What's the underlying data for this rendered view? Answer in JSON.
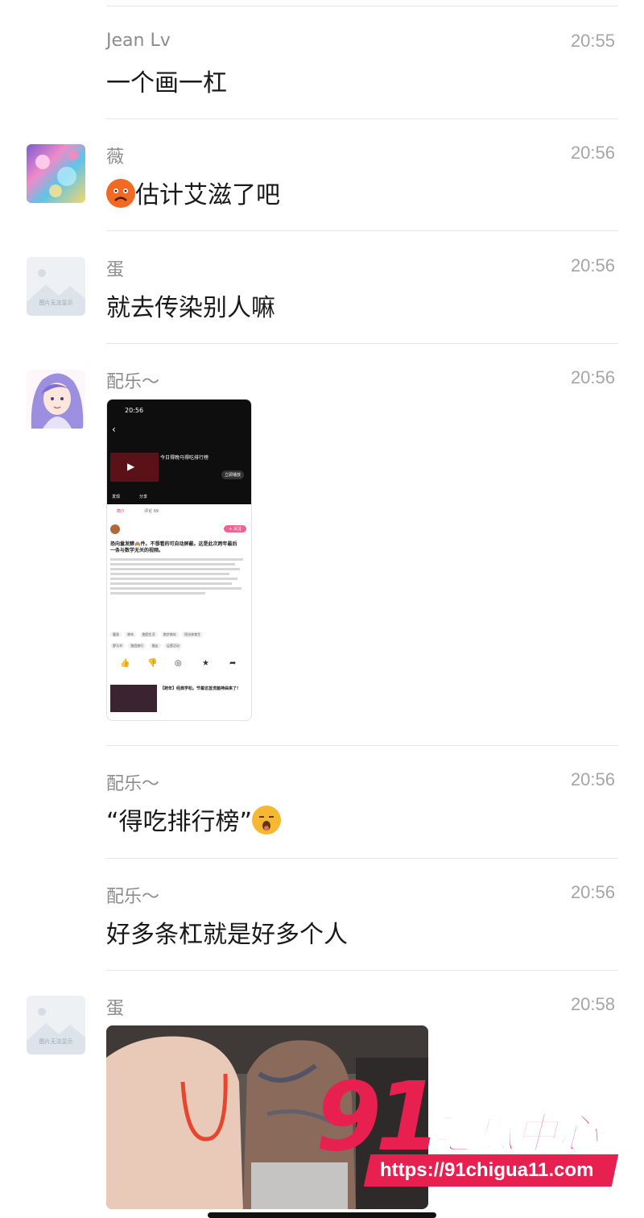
{
  "messages": [
    {
      "sender": "Jean Lv",
      "time": "20:55",
      "text": "一个画一杠"
    },
    {
      "sender": "薇",
      "time": "20:56",
      "text": "估计艾滋了吧"
    },
    {
      "sender": "蛋",
      "time": "20:56",
      "text": "就去传染别人嘛"
    },
    {
      "sender": "配乐～",
      "time": "20:56"
    },
    {
      "sender": "配乐～",
      "time": "20:56",
      "text": "“得吃排行榜”"
    },
    {
      "sender": "配乐～",
      "time": "20:56",
      "text": "好多条杠就是好多个人"
    },
    {
      "sender": "蛋",
      "time": "20:58"
    }
  ],
  "placeholder_avatar_caption": "图片无法显示",
  "screenshot": {
    "status_time": "20:56",
    "video_title": "今日得晚马得吃排行榜",
    "play_button": "立即播放",
    "actions": [
      "发现",
      "分享"
    ],
    "tabs": [
      "简介",
      "评论 99"
    ],
    "follow_label": "+ 关注",
    "post_headline": "恐向童发酵🙈件。不想看的可自动屏蔽。这是此次跨年最后一条与数学无关的视频。",
    "tags": [
      "健身",
      "跨年",
      "跑团生活",
      "跑步跨年",
      "阳光体育生",
      "野马书",
      "跑团旅行",
      "推友",
      "运营活动"
    ],
    "rec_title": "【跨年】经典学松。节着这首洗脑神曲来了!"
  },
  "watermark": {
    "number": "91",
    "brand": "吃瓜中心",
    "url": "https://91chigua11.com"
  },
  "colors": {
    "watermark_red": "#e8204f",
    "sender_gray": "#8c8c8c",
    "time_gray": "#a5a5a5",
    "divider": "#e6e6e6"
  }
}
